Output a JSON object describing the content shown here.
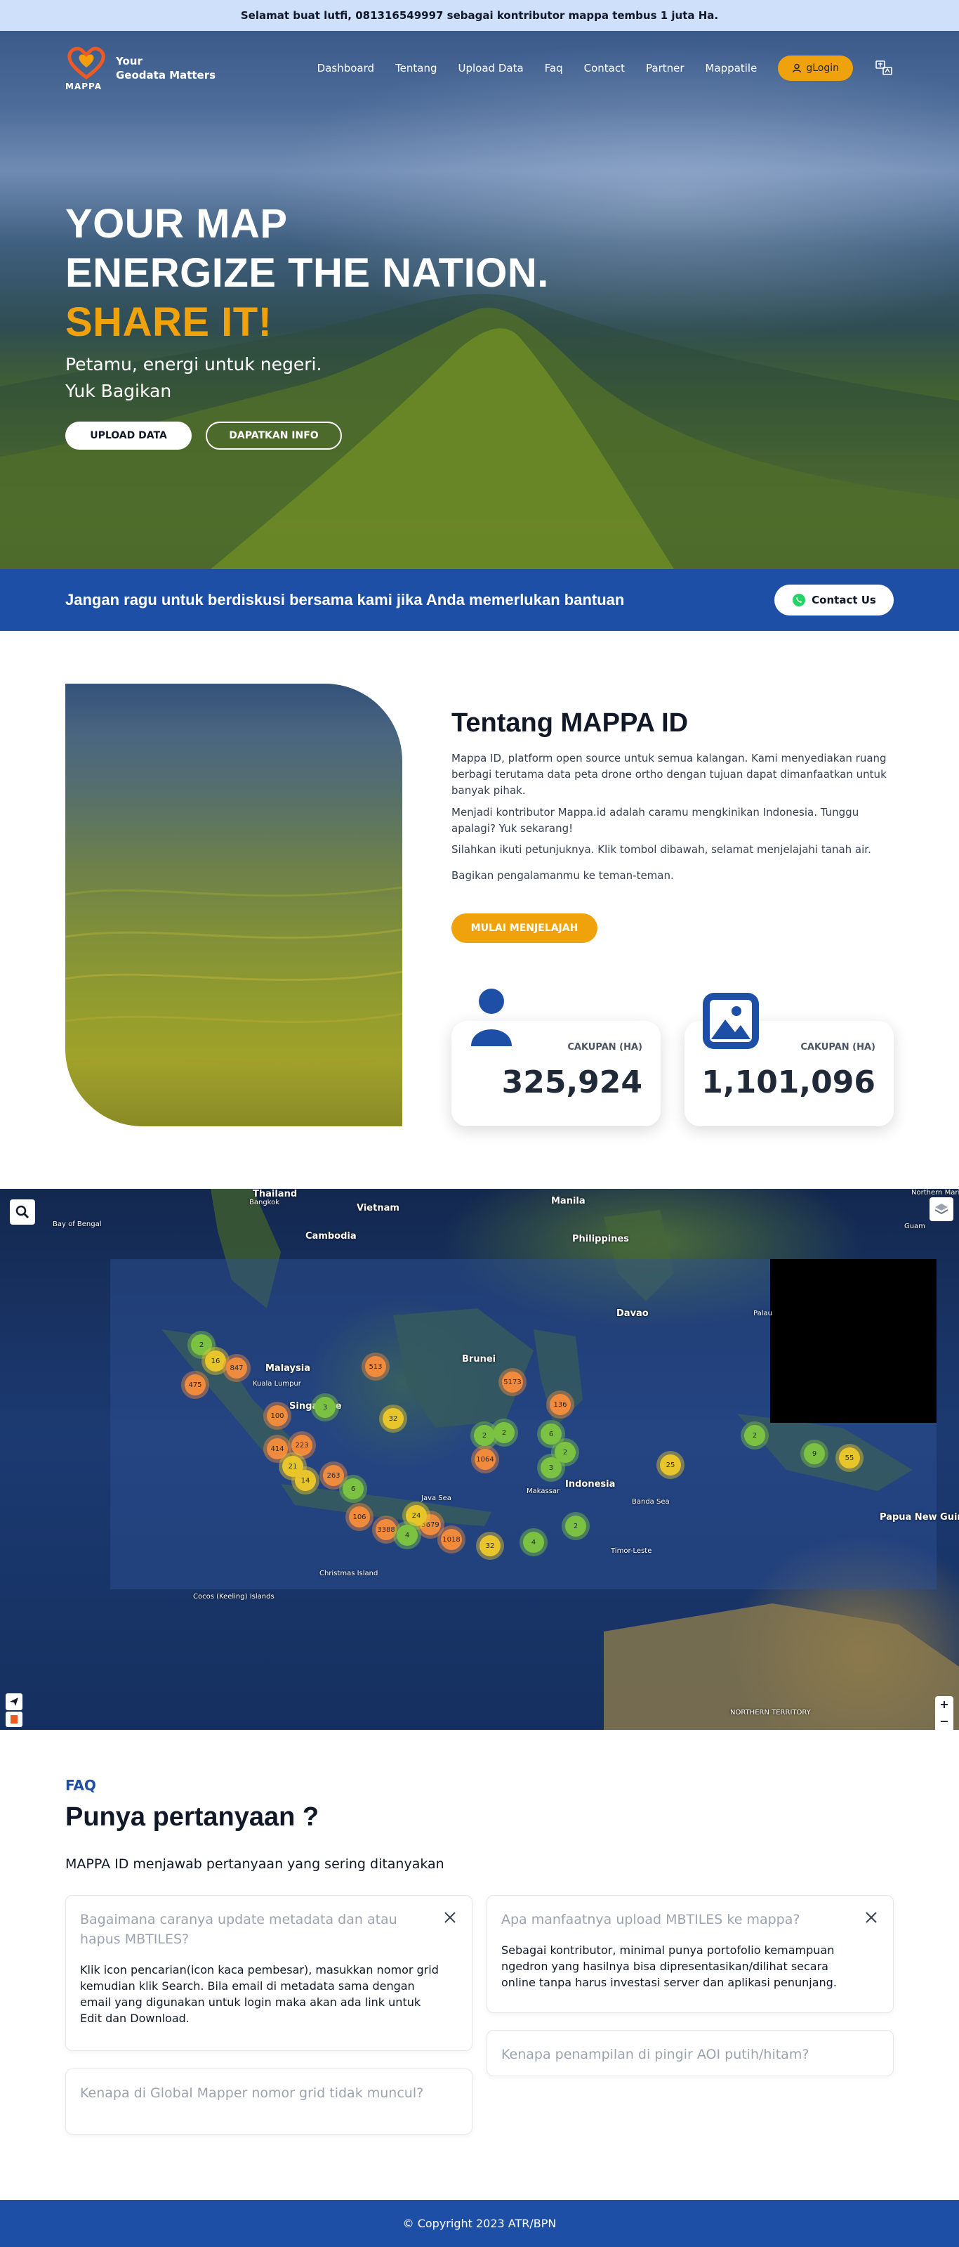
{
  "announcement": "Selamat buat lutfi, 081316549997 sebagai kontributor mappa tembus 1 juta Ha.",
  "brand": {
    "name": "MAPPA",
    "tagline_line1": "Your",
    "tagline_line2": "Geodata Matters"
  },
  "nav": {
    "items": [
      "Dashboard",
      "Tentang",
      "Upload Data",
      "Faq",
      "Contact",
      "Partner",
      "Mappatile"
    ],
    "login_label": "gLogin",
    "language_icon": "translate-icon"
  },
  "hero": {
    "line1": "YOUR MAP",
    "line2": "ENERGIZE THE NATION.",
    "line3": "SHARE IT!",
    "sub1": "Petamu, energi untuk negeri.",
    "sub2": "Yuk Bagikan",
    "btn_upload": "UPLOAD DATA",
    "btn_info": "DAPATKAN INFO"
  },
  "helpband": {
    "text": "Jangan ragu untuk berdiskusi bersama kami jika Anda memerlukan bantuan",
    "contact_label": "Contact Us"
  },
  "about": {
    "title": "Tentang MAPPA ID",
    "p1": "Mappa ID, platform open source untuk semua kalangan. Kami menyediakan ruang berbagi terutama data peta drone ortho dengan tujuan dapat dimanfaatkan untuk banyak pihak.",
    "p2": "Menjadi kontributor Mappa.id adalah caramu mengkinikan Indonesia. Tunggu apalagi? Yuk sekarang!",
    "p3": "Silahkan ikuti petunjuknya. Klik tombol dibawah, selamat menjelajahi tanah air.",
    "p4": "Bagikan pengalamanmu ke teman-teman.",
    "explore_label": "MULAI MENJELAJAH",
    "stats": [
      {
        "label": "CAKUPAN (HA)",
        "value": "325,924",
        "icon": "user-icon"
      },
      {
        "label": "CAKUPAN (HA)",
        "value": "1,101,096",
        "icon": "image-icon"
      }
    ]
  },
  "map": {
    "labels": [
      "Thailand",
      "Bangkok",
      "Vietnam",
      "Manila",
      "Cambodia",
      "Philippines",
      "Bay of Bengal",
      "Malaysia",
      "Kuala Lumpur",
      "Brunei",
      "Singapore",
      "Davao",
      "Palau",
      "Indonesia",
      "Makassar",
      "Timor-Leste",
      "Christmas Island",
      "Cocos (Keeling) Islands",
      "Papua New Guinea",
      "Guam",
      "Northern Mariana Islands",
      "NORTHERN TERRITORY",
      "Java Sea",
      "Banda Sea"
    ],
    "clusters": [
      {
        "n": "2",
        "c": "green"
      },
      {
        "n": "16",
        "c": "yellow"
      },
      {
        "n": "847",
        "c": "orange"
      },
      {
        "n": "475",
        "c": "orange"
      },
      {
        "n": "513",
        "c": "orange"
      },
      {
        "n": "5173",
        "c": "orange"
      },
      {
        "n": "100",
        "c": "orange"
      },
      {
        "n": "3",
        "c": "green"
      },
      {
        "n": "32",
        "c": "yellow"
      },
      {
        "n": "136",
        "c": "orange"
      },
      {
        "n": "414",
        "c": "orange"
      },
      {
        "n": "223",
        "c": "orange"
      },
      {
        "n": "21",
        "c": "yellow"
      },
      {
        "n": "14",
        "c": "yellow"
      },
      {
        "n": "263",
        "c": "orange"
      },
      {
        "n": "6",
        "c": "green"
      },
      {
        "n": "2",
        "c": "green"
      },
      {
        "n": "2",
        "c": "green"
      },
      {
        "n": "1064",
        "c": "orange"
      },
      {
        "n": "6",
        "c": "green"
      },
      {
        "n": "3",
        "c": "green"
      },
      {
        "n": "2",
        "c": "green"
      },
      {
        "n": "25",
        "c": "yellow"
      },
      {
        "n": "2",
        "c": "green"
      },
      {
        "n": "9",
        "c": "green"
      },
      {
        "n": "55",
        "c": "yellow"
      },
      {
        "n": "106",
        "c": "orange"
      },
      {
        "n": "3388",
        "c": "orange"
      },
      {
        "n": "5679",
        "c": "orange"
      },
      {
        "n": "1018",
        "c": "orange"
      },
      {
        "n": "32",
        "c": "yellow"
      },
      {
        "n": "4",
        "c": "green"
      },
      {
        "n": "2",
        "c": "green"
      },
      {
        "n": "24",
        "c": "yellow"
      },
      {
        "n": "4",
        "c": "green"
      }
    ],
    "zoom_in": "+",
    "zoom_out": "−"
  },
  "faq": {
    "kicker": "FAQ",
    "title": "Punya pertanyaan ?",
    "subtitle": "MAPPA ID menjawab pertanyaan yang sering ditanyakan",
    "items": [
      {
        "q": "Bagaimana caranya update metadata dan atau hapus MBTILES?",
        "a": "Klik icon pencarian(icon kaca pembesar), masukkan nomor grid kemudian klik Search. Bila email di metadata sama dengan email yang digunakan untuk login maka akan ada link untuk Edit dan Download."
      },
      {
        "q": "Apa manfaatnya upload MBTILES ke mappa?",
        "a": "Sebagai kontributor, minimal punya portofolio kemampuan ngedron yang hasilnya bisa dipresentasikan/dilihat secara online tanpa harus investasi server dan aplikasi penunjang."
      },
      {
        "q": "Kenapa penampilan di pingir AOI putih/hitam?",
        "a": ""
      },
      {
        "q": "Kenapa di Global Mapper nomor grid tidak muncul?",
        "a": ""
      }
    ]
  },
  "footer": "© Copyright 2023 ATR/BPN"
}
